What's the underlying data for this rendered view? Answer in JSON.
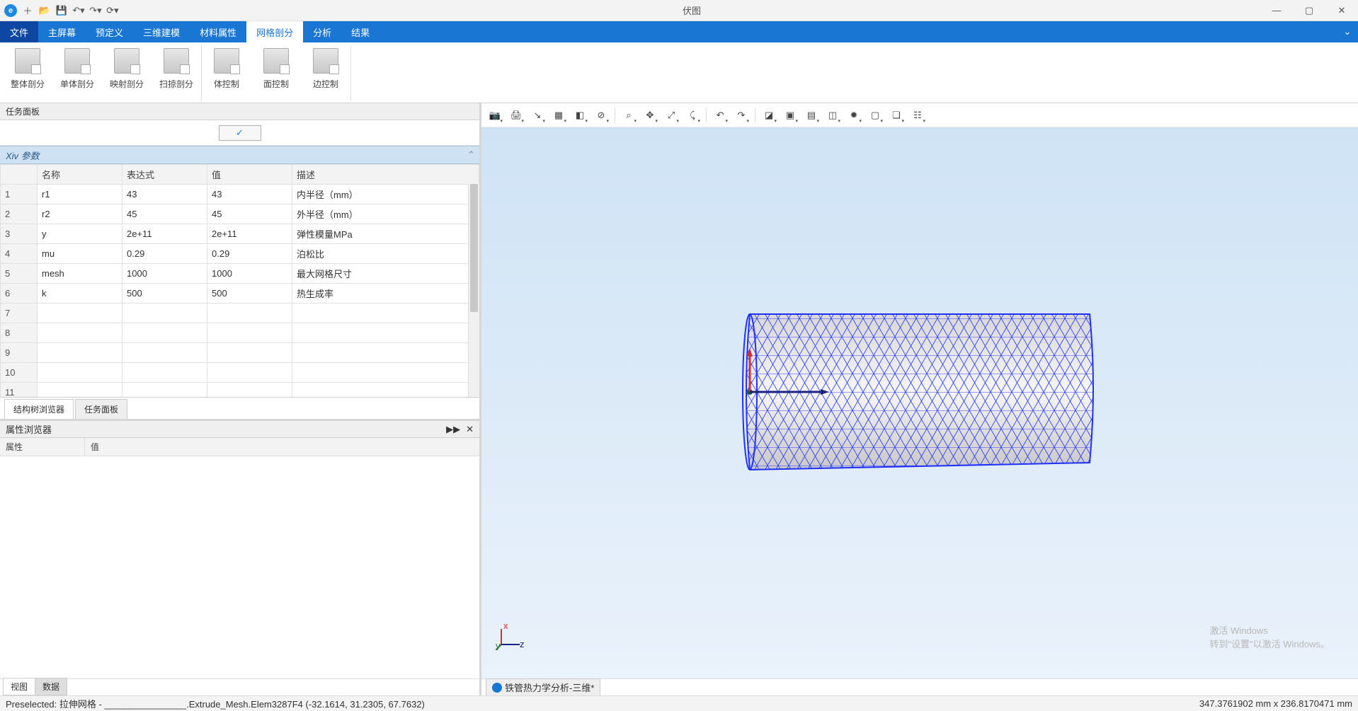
{
  "app": {
    "title": "伏图"
  },
  "qat_icons": [
    "app-logo",
    "new-icon",
    "open-icon",
    "save-icon",
    "undo-icon",
    "redo-icon",
    "refresh-icon"
  ],
  "menutabs": {
    "file": "文件",
    "items": [
      "主屏幕",
      "预定义",
      "三维建模",
      "材料属性",
      "网格剖分",
      "分析",
      "结果"
    ],
    "active": "网格剖分"
  },
  "ribbon": {
    "group1": [
      "整体剖分",
      "单体剖分",
      "映射剖分",
      "扫掠剖分"
    ],
    "group2": [
      "体控制",
      "面控制",
      "边控制"
    ]
  },
  "left": {
    "task_panel_title": "任务面板",
    "params_title": "Xiv 参数",
    "headers": {
      "name": "名称",
      "expr": "表达式",
      "value": "值",
      "desc": "描述"
    },
    "rows": [
      {
        "n": "1",
        "name": "r1",
        "expr": "43",
        "value": "43",
        "desc": "内半径（mm）"
      },
      {
        "n": "2",
        "name": "r2",
        "expr": "45",
        "value": "45",
        "desc": "外半径（mm）"
      },
      {
        "n": "3",
        "name": "y",
        "expr": "2e+11",
        "value": "2e+11",
        "desc": "弹性模量MPa"
      },
      {
        "n": "4",
        "name": "mu",
        "expr": "0.29",
        "value": "0.29",
        "desc": "泊松比"
      },
      {
        "n": "5",
        "name": "mesh",
        "expr": "1000",
        "value": "1000",
        "desc": "最大网格尺寸"
      },
      {
        "n": "6",
        "name": "k",
        "expr": "500",
        "value": "500",
        "desc": "热生成率"
      },
      {
        "n": "7",
        "name": "",
        "expr": "",
        "value": "",
        "desc": ""
      },
      {
        "n": "8",
        "name": "",
        "expr": "",
        "value": "",
        "desc": ""
      },
      {
        "n": "9",
        "name": "",
        "expr": "",
        "value": "",
        "desc": ""
      },
      {
        "n": "10",
        "name": "",
        "expr": "",
        "value": "",
        "desc": ""
      },
      {
        "n": "11",
        "name": "",
        "expr": "",
        "value": "",
        "desc": ""
      }
    ],
    "bottom_tabs": {
      "tree": "结构树浏览器",
      "task": "任务面板",
      "active": "task"
    },
    "prop": {
      "title": "属性浏览器",
      "col1": "属性",
      "col2": "值",
      "tabs": {
        "view": "视图",
        "data": "数据",
        "active": "data"
      }
    }
  },
  "viewport_tools": [
    "camera-icon",
    "print-icon",
    "axes-icon",
    "layers-icon",
    "eraser-icon",
    "no-entry-icon",
    "|",
    "zoom-window-icon",
    "pan-icon",
    "fit-icon",
    "orient-icon",
    "|",
    "undo-view-icon",
    "redo-view-icon",
    "|",
    "solid-icon",
    "wireframe-icon",
    "shaded-icon",
    "section-icon",
    "light-icon",
    "box-icon",
    "cube-icon",
    "layers2-icon"
  ],
  "watermark": {
    "l1": "激活 Windows",
    "l2": "转到\"设置\"以激活 Windows。"
  },
  "doc_tab": "铁管热力学分析-三维*",
  "status": {
    "left": "Preselected: 拉伸网格 - ________________.Extrude_Mesh.Elem3287F4 (-32.1614, 31.2305, 67.7632)",
    "right": "347.3761902 mm x 236.8170471 mm"
  },
  "triad_labels": {
    "x": "x",
    "y": "y",
    "z": "z"
  }
}
